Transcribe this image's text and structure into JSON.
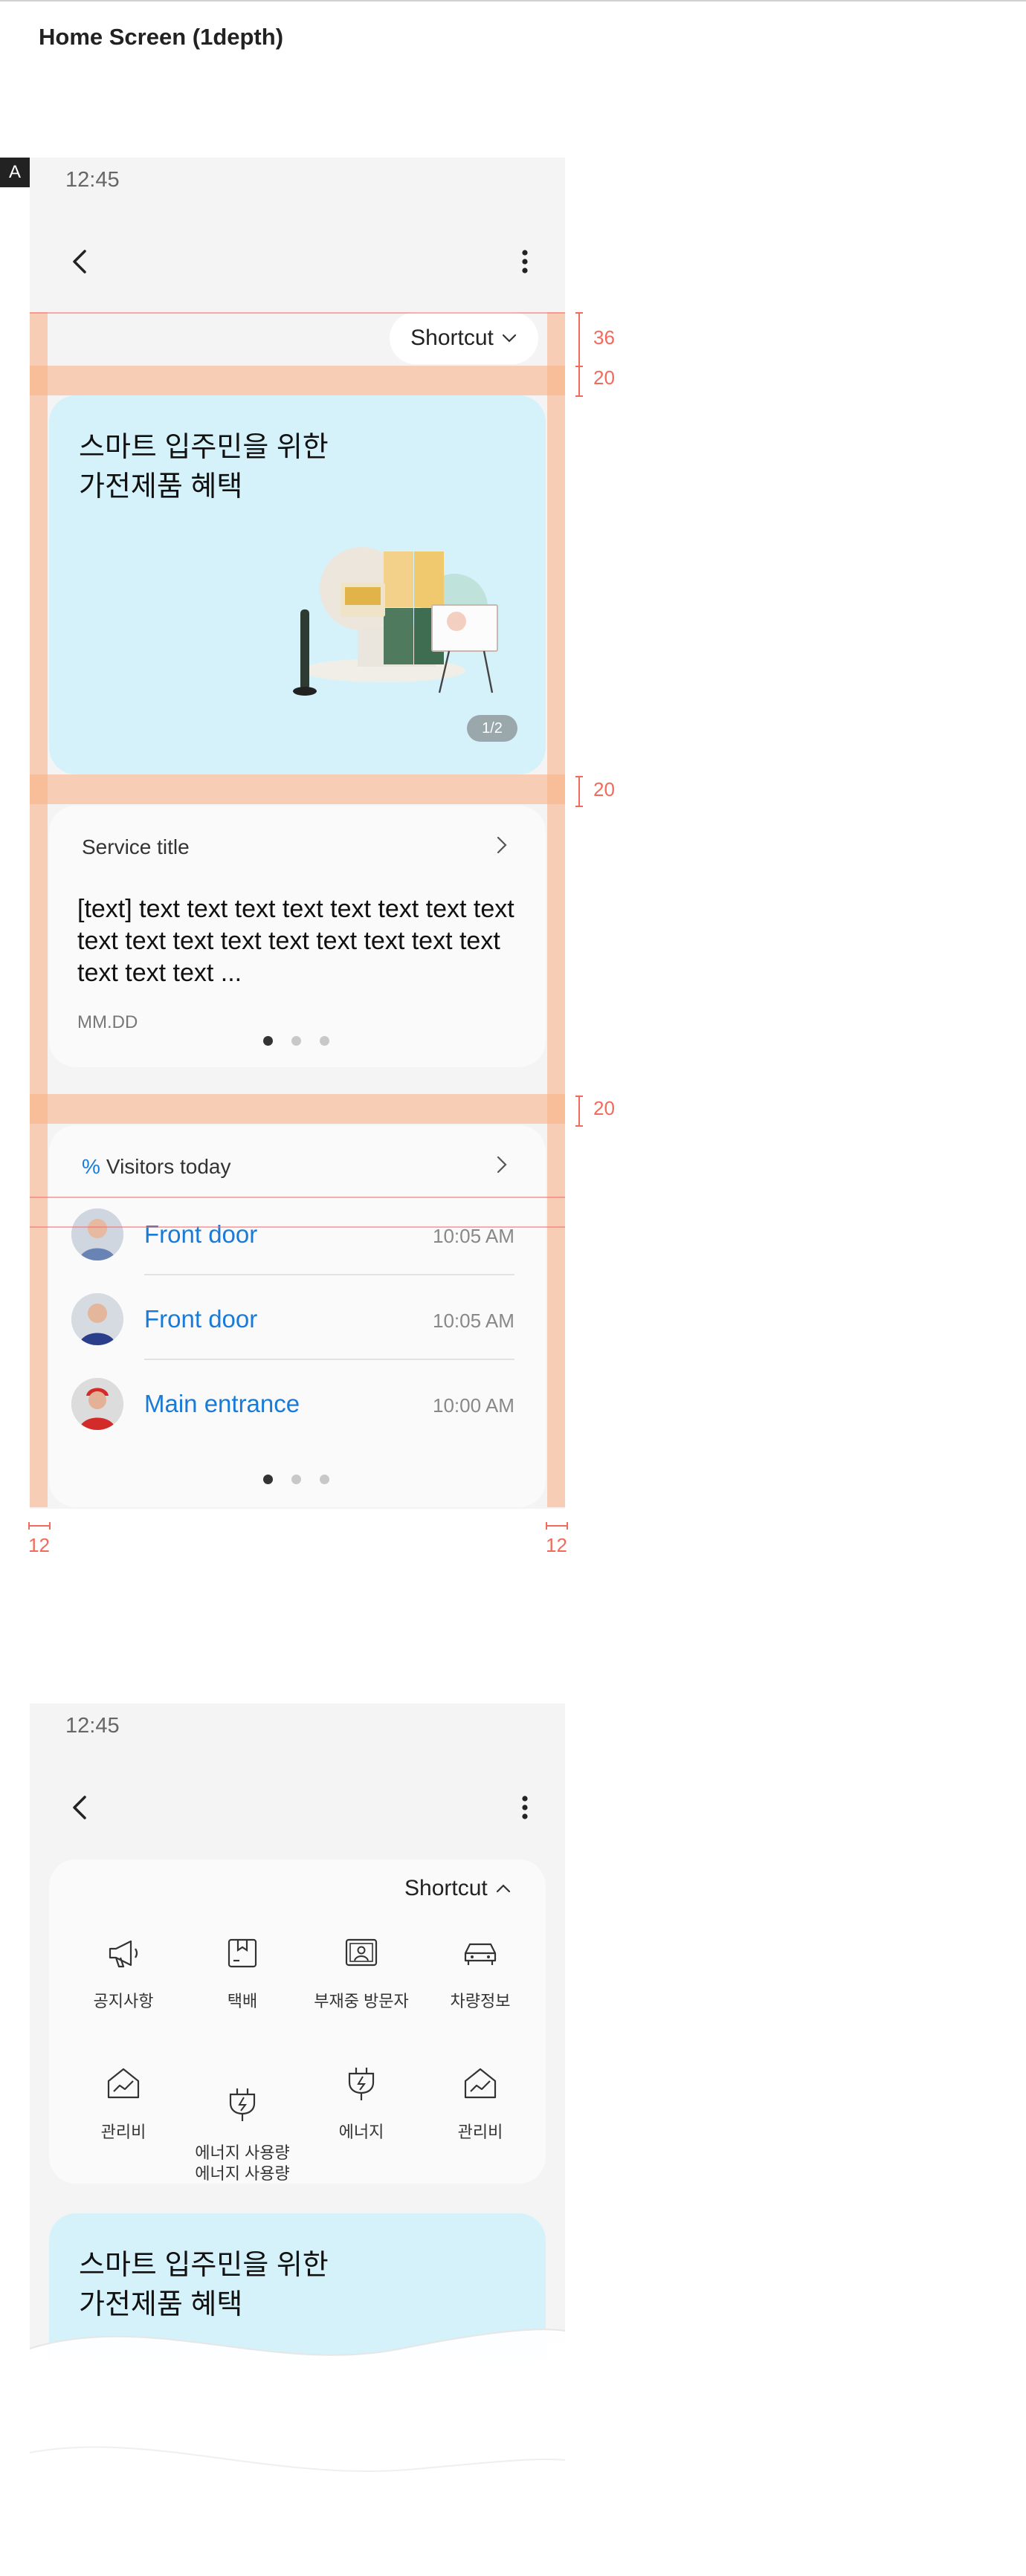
{
  "page_title": "Home Screen (1depth)",
  "screen_marker": "A",
  "screen1": {
    "status_time": "12:45",
    "shortcut_label": "Shortcut",
    "hero": {
      "title_line1": "스마트 입주민을 위한",
      "title_line2": "가전제품 혜택",
      "pager": "1/2"
    },
    "service": {
      "title": "Service title",
      "body": "[text] text text text text text text text text text text text text text text text text text text text text ...",
      "date": "MM.DD"
    },
    "visitors": {
      "prefix": "%",
      "title": "Visitors today",
      "rows": [
        {
          "name": "Front door",
          "time": "10:05 AM"
        },
        {
          "name": "Front door",
          "time": "10:05 AM"
        },
        {
          "name": "Main entrance",
          "time": "10:00 AM"
        }
      ]
    }
  },
  "spec_labels": {
    "shortcut_height": "36",
    "gap_1": "20",
    "gap_2": "20",
    "gap_3": "20",
    "margin_left": "12",
    "margin_right": "12"
  },
  "screen2": {
    "status_time": "12:45",
    "shortcut_label": "Shortcut",
    "grid_items": [
      {
        "label": "공지사항",
        "icon": "megaphone-icon"
      },
      {
        "label": "택배",
        "icon": "package-icon"
      },
      {
        "label": "부재중 방문자",
        "icon": "missed-visitor-icon"
      },
      {
        "label": "차량정보",
        "icon": "car-icon"
      },
      {
        "label": "관리비",
        "icon": "fee-chart-icon"
      },
      {
        "label": "에너지 사용량\n에너지 사용량",
        "icon": "energy-plug-icon"
      },
      {
        "label": "에너지",
        "icon": "energy-plug-icon"
      },
      {
        "label": "관리비",
        "icon": "fee-chart-icon"
      }
    ],
    "hero_title_line1": "스마트 입주민을 위한",
    "hero_title_line2": "가전제품 혜택"
  },
  "colors": {
    "accent_blue": "#1a7ad8",
    "hero_bg": "#d5f2fb",
    "spec_overlay": "#faaf82",
    "spec_text": "#f26a5c"
  }
}
